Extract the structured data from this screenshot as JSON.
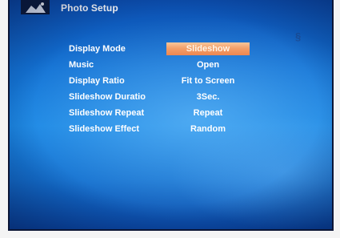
{
  "screen": {
    "title": "Photo Setup",
    "header_icon": "photo-icon",
    "corner_glyph": "§"
  },
  "menu": {
    "rows": [
      {
        "label": "Display Mode",
        "value": "Slideshow",
        "selected": true
      },
      {
        "label": "Music",
        "value": "Open",
        "selected": false
      },
      {
        "label": "Display Ratio",
        "value": "Fit to Screen",
        "selected": false
      },
      {
        "label": "Slideshow Duratio",
        "value": "3Sec.",
        "selected": false
      },
      {
        "label": "Slideshow Repeat",
        "value": "Repeat",
        "selected": false
      },
      {
        "label": "Slideshow Effect",
        "value": "Random",
        "selected": false
      }
    ]
  },
  "colors": {
    "background": "#1a86e3",
    "highlight": "#f3a06a",
    "text": "#ffffff"
  }
}
